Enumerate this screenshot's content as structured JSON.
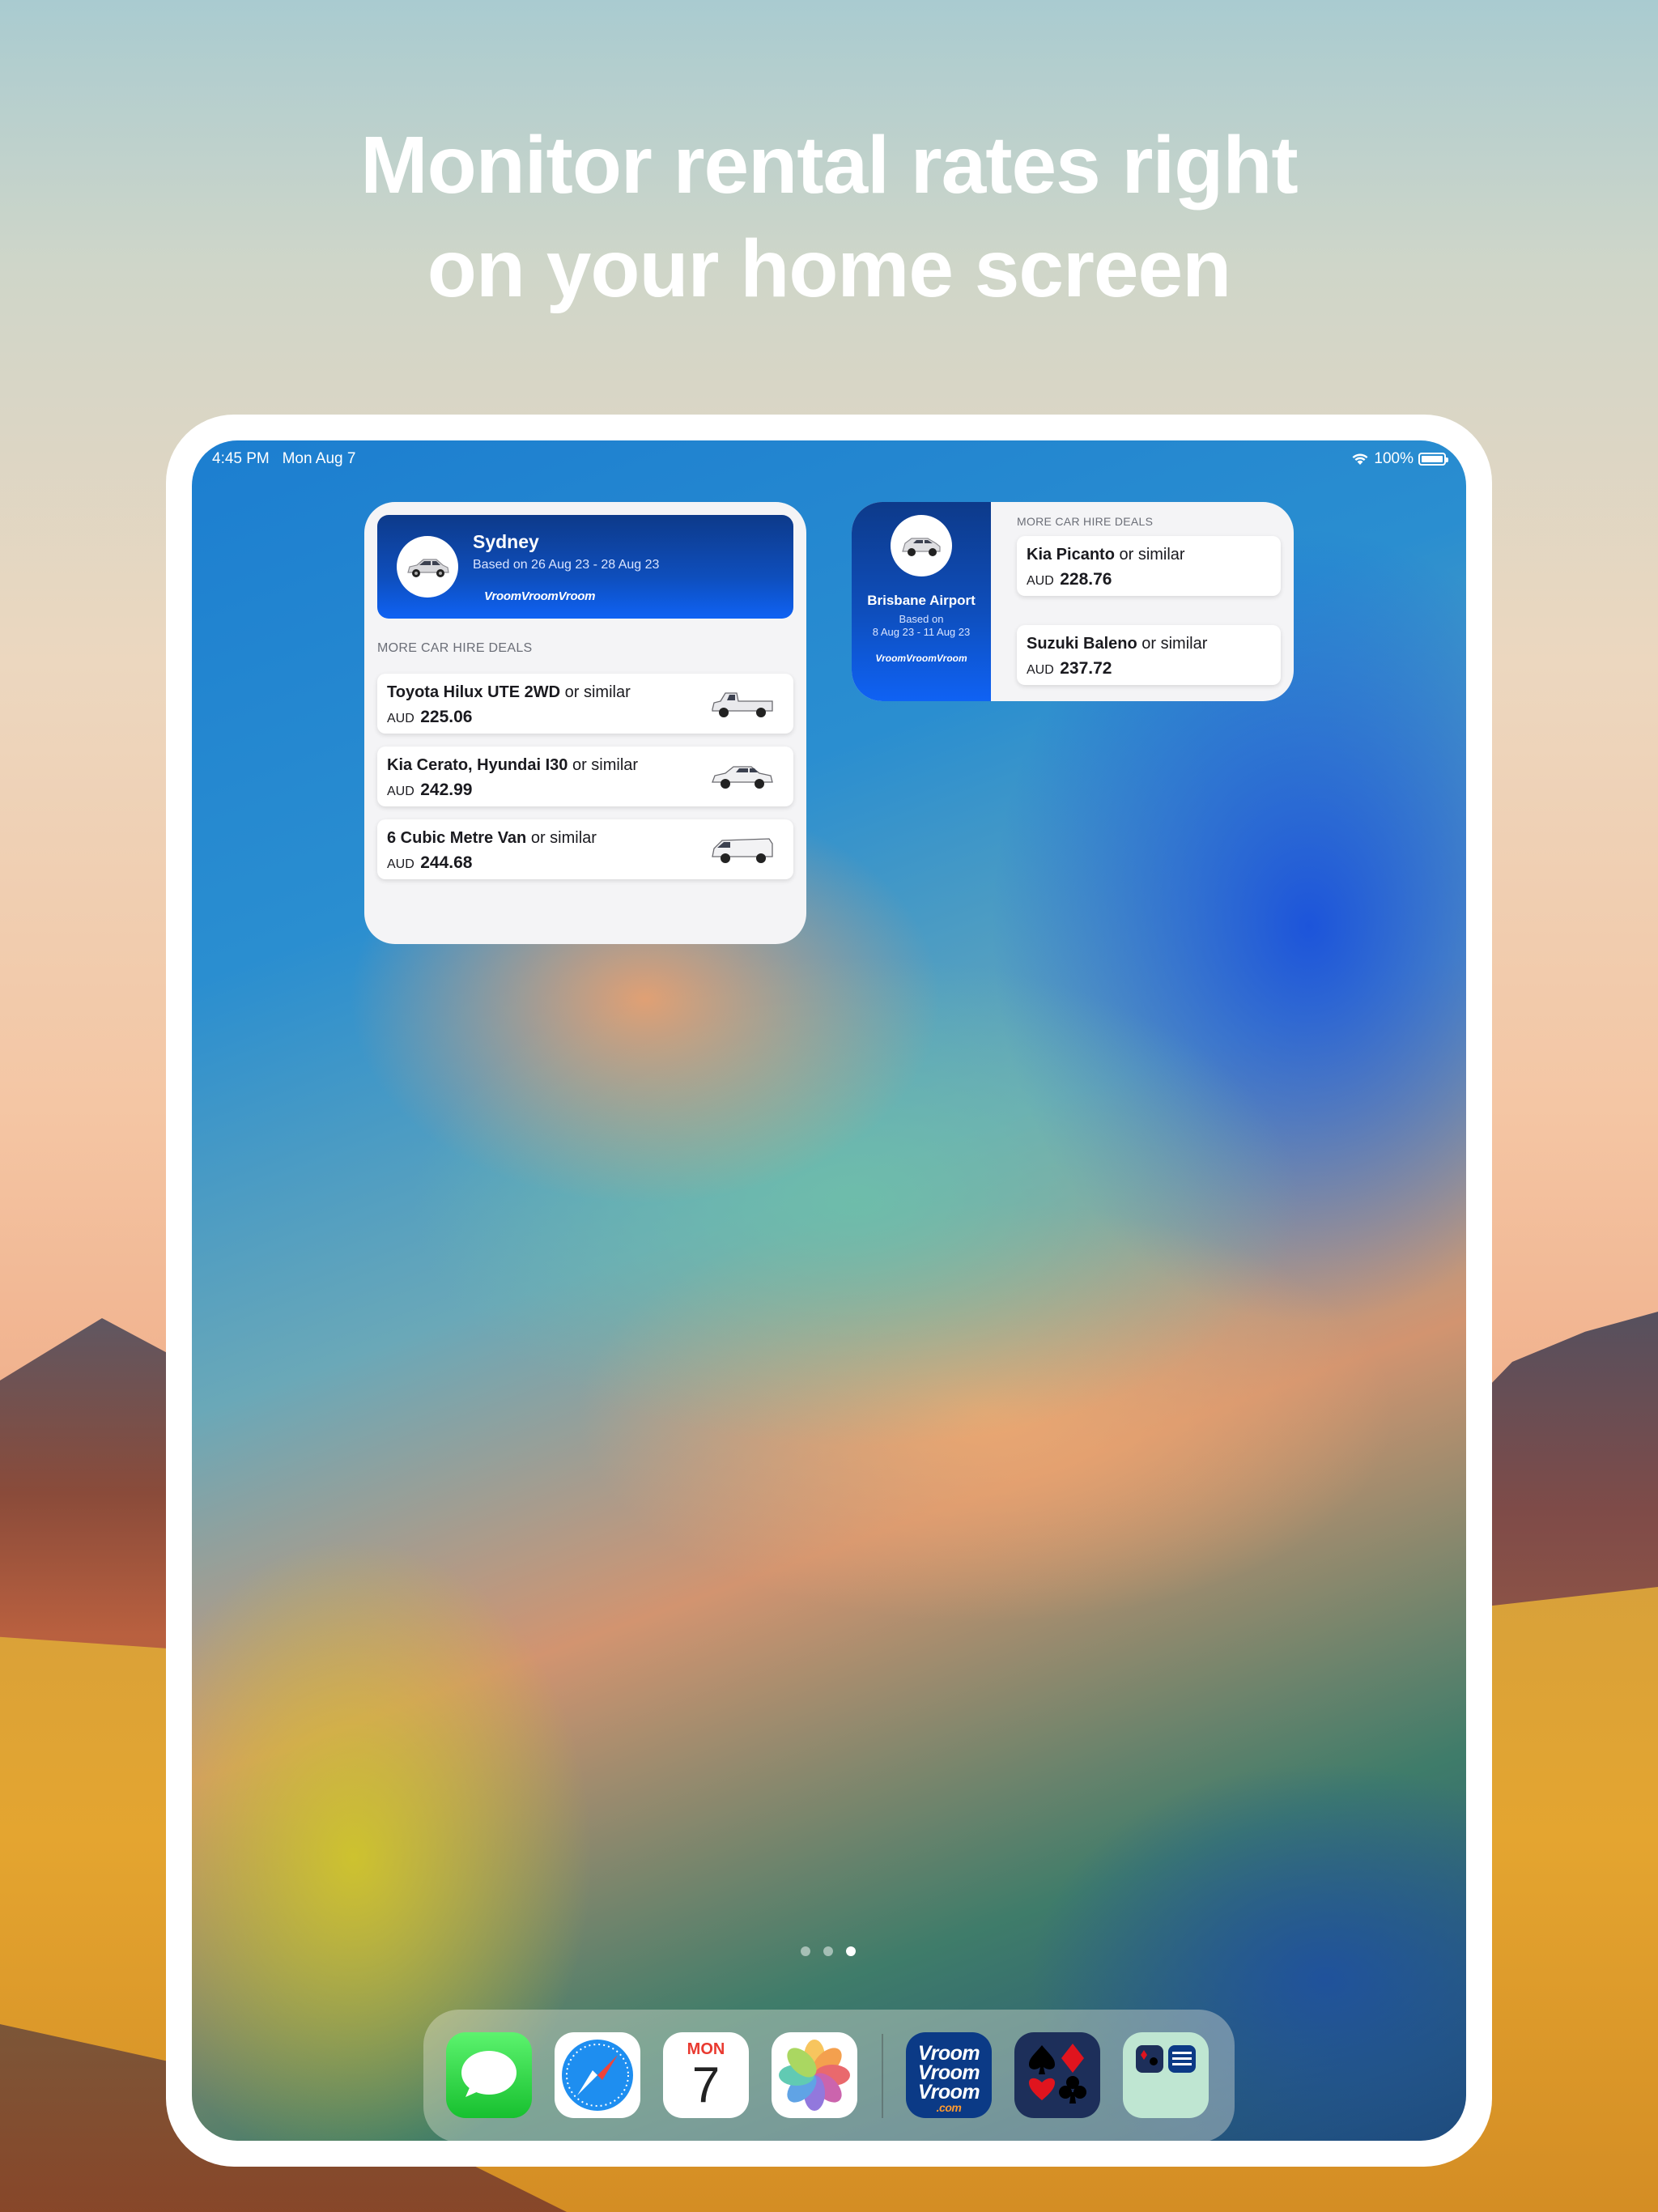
{
  "headline": {
    "line1": "Monitor rental rates right",
    "line2": "on your home screen"
  },
  "status_bar": {
    "time": "4:45 PM",
    "date": "Mon Aug 7",
    "battery": "100%",
    "icons": [
      "wifi-icon",
      "battery-icon"
    ]
  },
  "sydney_widget": {
    "city": "Sydney",
    "dates": "Based on 26 Aug 23 - 28 Aug 23",
    "brand": "VroomVroomVroom",
    "section_label": "MORE CAR HIRE DEALS",
    "deals": [
      {
        "name": "Toyota Hilux UTE 2WD",
        "suffix": " or similar",
        "currency": "AUD",
        "price": "225.06",
        "image": "ute-icon"
      },
      {
        "name": "Kia Cerato, Hyundai I30",
        "suffix": " or similar",
        "currency": "AUD",
        "price": "242.99",
        "image": "sedan-icon"
      },
      {
        "name": "6 Cubic Metre Van",
        "suffix": " or similar",
        "currency": "AUD",
        "price": "244.68",
        "image": "van-icon"
      }
    ]
  },
  "brisbane_widget": {
    "city": "Brisbane Airport",
    "based_on": "Based on",
    "dates": "8 Aug 23 - 11 Aug 23",
    "brand": "VroomVroomVroom",
    "section_label": "MORE CAR HIRE DEALS",
    "deals": [
      {
        "name": "Kia Picanto",
        "suffix": " or similar",
        "currency": "AUD",
        "price": "228.76"
      },
      {
        "name": "Suzuki Baleno",
        "suffix": " or similar",
        "currency": "AUD",
        "price": "237.72"
      }
    ]
  },
  "page_dots": {
    "count": 3,
    "active_index": 2
  },
  "dock": {
    "apps": [
      "Messages",
      "Safari",
      "Calendar",
      "Photos",
      "VroomVroomVroom",
      "Cards",
      "Folder"
    ],
    "calendar": {
      "day": "MON",
      "date": "7"
    },
    "vroom_icon_text": [
      "Vroom",
      "Vroom",
      "Vroom",
      ".com"
    ]
  },
  "colors": {
    "widget_blue_top": "#0d3a8a",
    "widget_blue_bottom": "#0f62f4",
    "calendar_red": "#e93a30"
  }
}
